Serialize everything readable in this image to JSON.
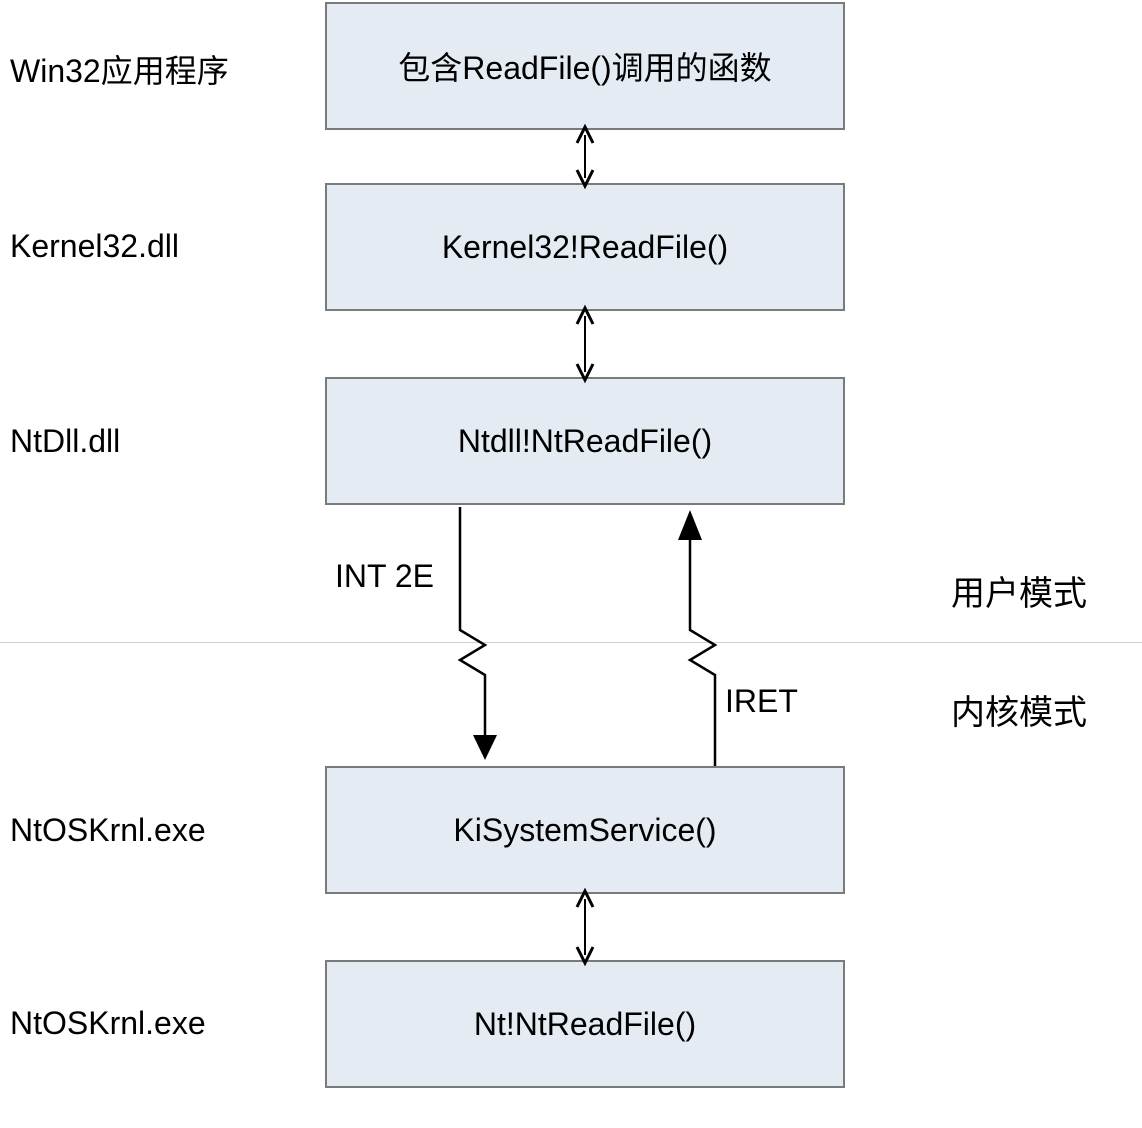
{
  "labels": {
    "row1": "Win32应用程序",
    "row2": "Kernel32.dll",
    "row3": "NtDll.dll",
    "row4": "NtOSKrnl.exe",
    "row5": "NtOSKrnl.exe"
  },
  "boxes": {
    "box1": "包含ReadFile()调用的函数",
    "box2": "Kernel32!ReadFile()",
    "box3": "Ntdll!NtReadFile()",
    "box4": "KiSystemService()",
    "box5": "Nt!NtReadFile()"
  },
  "annotations": {
    "int2e": "INT 2E",
    "iret": "IRET"
  },
  "modes": {
    "user": "用户模式",
    "kernel": "内核模式"
  }
}
